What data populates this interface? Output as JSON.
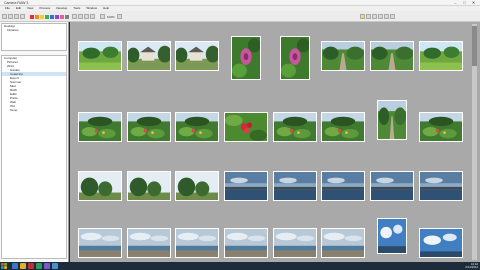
{
  "window": {
    "title": "Camera RAW 3",
    "controls": [
      "–",
      "□",
      "✕"
    ]
  },
  "menu": [
    "File",
    "Edit",
    "View",
    "Process",
    "Develop",
    "Tools",
    "Window",
    "Help"
  ],
  "toolbar": {
    "zoom_label": "100%"
  },
  "sidebar": {
    "top_tree": [
      {
        "label": "Desktop",
        "indent": 0,
        "selected": false
      },
      {
        "label": "Libraries",
        "indent": 1,
        "selected": false
      }
    ],
    "tree": [
      {
        "label": "Computer",
        "indent": 0,
        "selected": false
      },
      {
        "label": "Pictures",
        "indent": 1,
        "selected": false
      },
      {
        "label": "2014",
        "indent": 1,
        "selected": false
      },
      {
        "label": "Garden",
        "indent": 2,
        "selected": false
      },
      {
        "label": "Coast trip",
        "indent": 2,
        "selected": true
      },
      {
        "label": "Export",
        "indent": 2,
        "selected": false
      },
      {
        "label": "Summer",
        "indent": 2,
        "selected": false
      },
      {
        "label": "Misc",
        "indent": 2,
        "selected": false
      },
      {
        "label": "RAW",
        "indent": 2,
        "selected": false
      },
      {
        "label": "Edits",
        "indent": 2,
        "selected": false
      },
      {
        "label": "Prints",
        "indent": 2,
        "selected": false
      },
      {
        "label": "Web",
        "indent": 2,
        "selected": false
      },
      {
        "label": "Old",
        "indent": 2,
        "selected": false
      },
      {
        "label": "Temp",
        "indent": 2,
        "selected": false
      }
    ]
  },
  "thumbnails": [
    "garden-lawn",
    "house-trees",
    "house-trees",
    "pink-flower",
    "pink-flower",
    "garden-path",
    "garden-path",
    "garden-lawn",
    "garden-beds",
    "garden-beds",
    "garden-beds",
    "red-flower",
    "garden-beds",
    "garden-beds",
    "garden-path",
    "garden-beds",
    "trees-sky",
    "trees-sky",
    "trees-sky",
    "coast-sky",
    "coast-sky",
    "coast-sky",
    "coast-sky",
    "coast-sky",
    "beach-sky",
    "beach-sky",
    "beach-sky",
    "beach-sky",
    "beach-sky",
    "beach-sky",
    "blue-sky",
    "blue-sky"
  ],
  "colors": {
    "grid_bg": "#a9a9a9",
    "taskbar": "#1e2b3a"
  },
  "tray": {
    "time": "10:42",
    "date": "6/14/2014"
  }
}
